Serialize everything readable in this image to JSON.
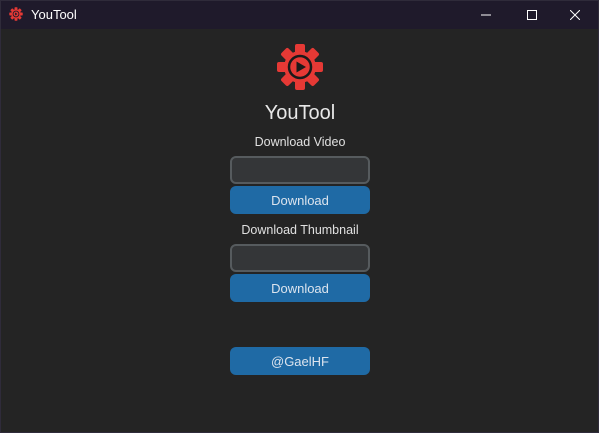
{
  "window": {
    "title": "YouTool",
    "icon": "gear-play-icon",
    "controls": [
      "minimize-icon",
      "maximize-icon",
      "close-icon"
    ]
  },
  "app": {
    "title": "YouTool",
    "logo": "gear-play-icon",
    "accent": "#e53935"
  },
  "video_section": {
    "label": "Download Video",
    "input_value": "",
    "button_label": "Download"
  },
  "thumbnail_section": {
    "label": "Download Thumbnail",
    "input_value": "",
    "button_label": "Download"
  },
  "footer": {
    "credit_label": "@GaelHF"
  },
  "colors": {
    "background": "#242424",
    "button": "#1f6aa5",
    "entry": "#343638",
    "entry_border": "#565b5e"
  }
}
